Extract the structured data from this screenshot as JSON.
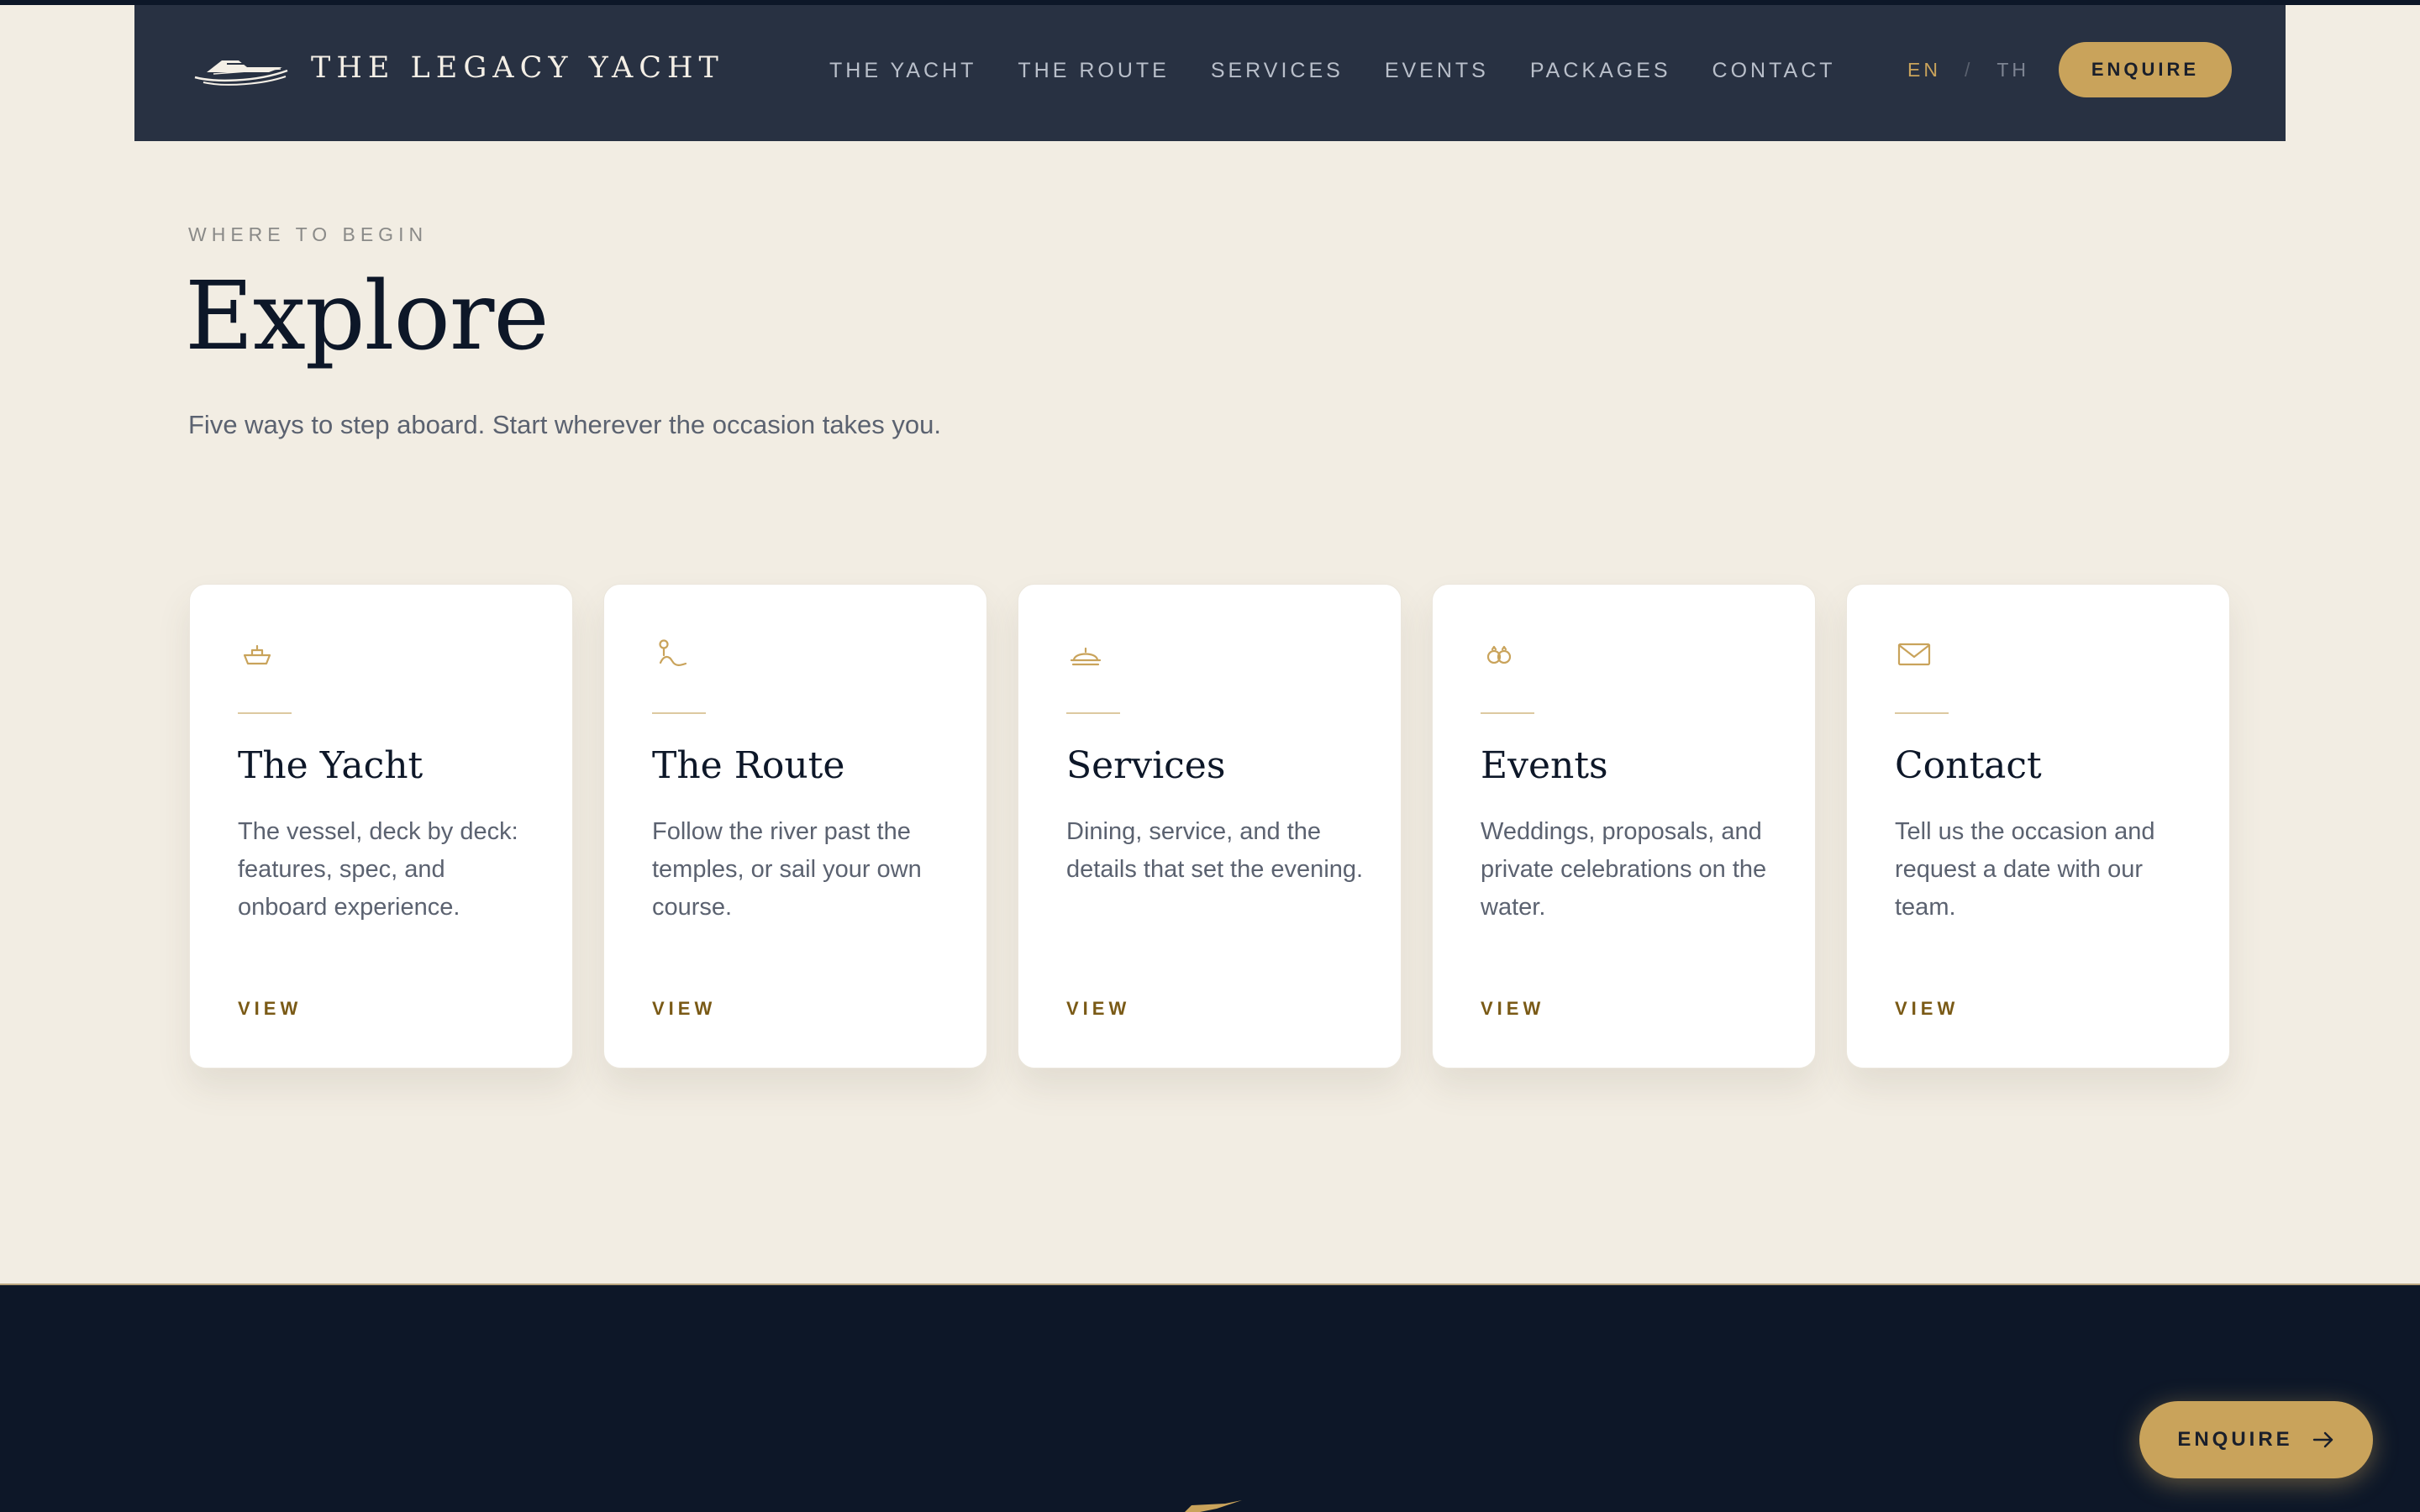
{
  "header": {
    "brand_name": "THE LEGACY YACHT",
    "logo_icon": "yacht-logo-icon",
    "nav": [
      {
        "label": "THE YACHT"
      },
      {
        "label": "THE ROUTE"
      },
      {
        "label": "SERVICES"
      },
      {
        "label": "EVENTS"
      },
      {
        "label": "PACKAGES"
      },
      {
        "label": "CONTACT"
      }
    ],
    "lang": {
      "active": "EN",
      "separator": "/",
      "other": "TH"
    },
    "enquire_label": "ENQUIRE"
  },
  "intro": {
    "eyebrow": "WHERE TO BEGIN",
    "title": "Explore",
    "subtitle": "Five ways to step aboard. Start wherever the occasion takes you."
  },
  "cards": [
    {
      "icon": "boat-icon",
      "title": "The Yacht",
      "text": "The vessel, deck by deck: features, spec, and onboard experience.",
      "link": "VIEW"
    },
    {
      "icon": "route-pin-icon",
      "title": "The Route",
      "text": "Follow the river past the temples, or sail your own course.",
      "link": "VIEW"
    },
    {
      "icon": "cloche-icon",
      "title": "Services",
      "text": "Dining, service, and the details that set the evening.",
      "link": "VIEW"
    },
    {
      "icon": "rings-icon",
      "title": "Events",
      "text": "Weddings, proposals, and private celebrations on the water.",
      "link": "VIEW"
    },
    {
      "icon": "envelope-icon",
      "title": "Contact",
      "text": "Tell us the occasion and request a date with our team.",
      "link": "VIEW"
    }
  ],
  "floating_enquire": {
    "label": "ENQUIRE",
    "icon": "arrow-right-icon"
  },
  "colors": {
    "accent_gold": "#c9a35b",
    "header_bg": "#283142",
    "page_bg": "#f2ede3",
    "footer_bg": "#0d1728",
    "heading": "#0d1728"
  }
}
